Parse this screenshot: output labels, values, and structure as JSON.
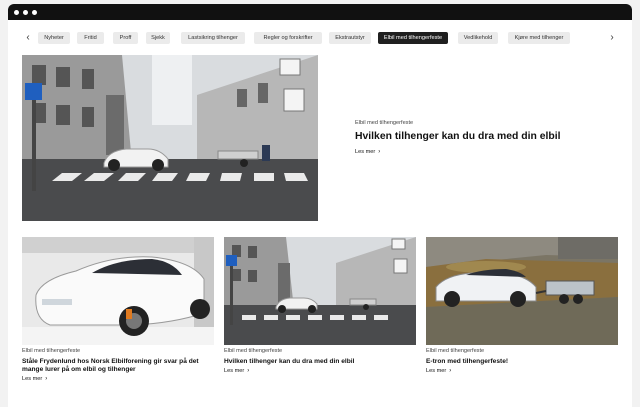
{
  "filters": {
    "prev_arrow": "‹",
    "next_arrow": "›",
    "chips": [
      {
        "label": "Nyheter"
      },
      {
        "label": "Fritid"
      },
      {
        "label": "Proff"
      },
      {
        "label": "Sjekk"
      },
      {
        "label": "Lastsikring tilhenger"
      },
      {
        "label": "Regler og forskrifter"
      },
      {
        "label": "Ekstrautstyr"
      },
      {
        "label": "Elbil med tilhengerfeste"
      },
      {
        "label": "Vedlikehold"
      },
      {
        "label": "Kjøre med tilhenger"
      }
    ],
    "active_index": 7
  },
  "featured": {
    "category": "Elbil med tilhengerfeste",
    "title": "Hvilken tilhenger kan du dra med din elbil",
    "read_more": "Les mer",
    "chevron": "›"
  },
  "cards": [
    {
      "category": "Elbil med tilhengerfeste",
      "title": "Ståle Frydenlund hos Norsk Elbilforening gir svar på det mange lurer på om elbil og tilhenger",
      "read_more": "Les mer",
      "chevron": "›"
    },
    {
      "category": "Elbil med tilhengerfeste",
      "title": "Hvilken tilhenger kan du dra med din elbil",
      "read_more": "Les mer",
      "chevron": "›"
    },
    {
      "category": "Elbil med tilhengerfeste",
      "title": "E-tron med tilhengerfeste!",
      "read_more": "Les mer",
      "chevron": "›"
    }
  ],
  "colors": {
    "active_chip": "#1f1f1f",
    "chip": "#ebebeb",
    "window_bar": "#111111"
  }
}
